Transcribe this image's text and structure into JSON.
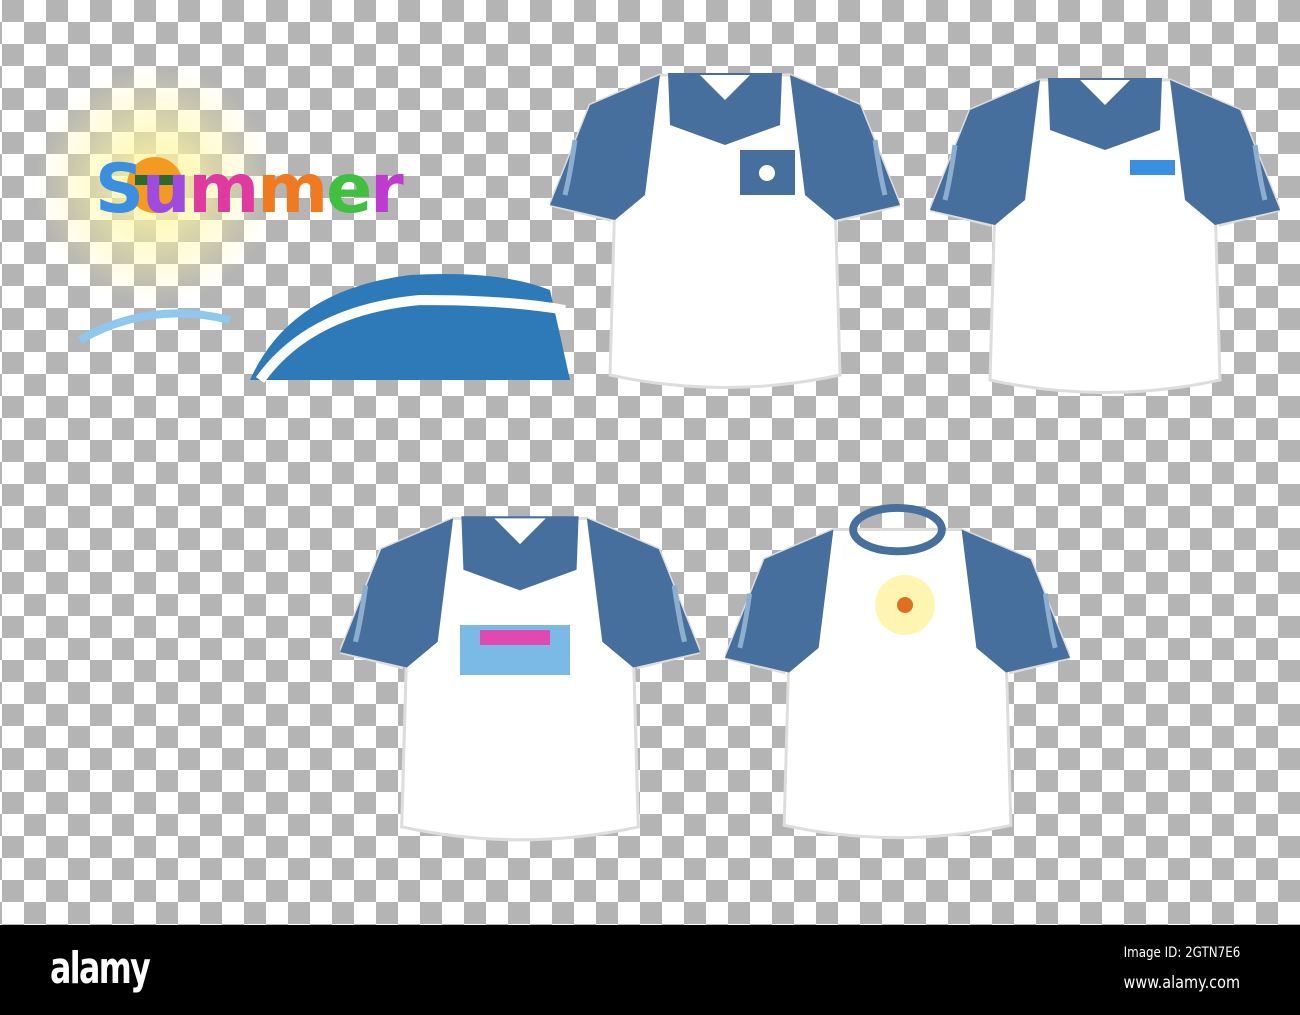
{
  "logo": {
    "text": "Summer",
    "colors": [
      "#3a8fe0",
      "#a04be0",
      "#e03aa0",
      "#f07a20",
      "#40c040",
      "#c03ad0"
    ]
  },
  "shirts": [
    {
      "style": "polo",
      "sleeve_color": "#466f9e",
      "print": "pocket"
    },
    {
      "style": "polo",
      "sleeve_color": "#466f9e",
      "print": "small-logo"
    },
    {
      "style": "polo",
      "sleeve_color": "#466f9e",
      "print": "summer-logo"
    },
    {
      "style": "crew-neck",
      "sleeve_color": "#466f9e",
      "print": "sun"
    }
  ],
  "footer": {
    "brand": "alamy",
    "image_id": "Image ID: 2GTN7E6",
    "url": "www.alamy.com"
  }
}
